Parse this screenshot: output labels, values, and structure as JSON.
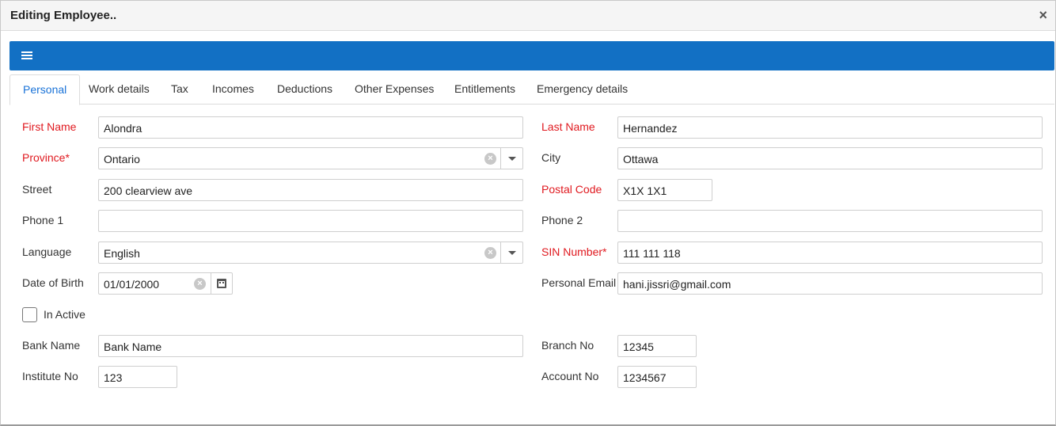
{
  "window": {
    "title": "Editing Employee..",
    "close_glyph": "×"
  },
  "toolbar": {
    "menu_icon": "hamburger-menu-icon",
    "color": "#1270c4"
  },
  "tabs": [
    {
      "label": "Personal",
      "active": true
    },
    {
      "label": "Work details"
    },
    {
      "label": "Tax"
    },
    {
      "label": "Incomes"
    },
    {
      "label": "Deductions"
    },
    {
      "label": "Other Expenses"
    },
    {
      "label": "Entitlements"
    },
    {
      "label": "Emergency details"
    }
  ],
  "colors": {
    "accent": "#1a73d8",
    "required_label": "#e0191f"
  },
  "form": {
    "first_name": {
      "label": "First Name",
      "value": "Alondra",
      "required": true
    },
    "last_name": {
      "label": "Last Name",
      "value": "Hernandez",
      "required": true
    },
    "province": {
      "label": "Province*",
      "value": "Ontario",
      "required": true
    },
    "city": {
      "label": "City",
      "value": "Ottawa"
    },
    "street": {
      "label": "Street",
      "value": "200 clearview ave"
    },
    "postal_code": {
      "label": "Postal Code",
      "value": "X1X 1X1",
      "required": true
    },
    "phone1": {
      "label": "Phone 1",
      "value": ""
    },
    "phone2": {
      "label": "Phone 2",
      "value": ""
    },
    "language": {
      "label": "Language",
      "value": "English"
    },
    "sin": {
      "label": "SIN Number*",
      "value": "111 111 118",
      "required": true
    },
    "dob": {
      "label": "Date of Birth",
      "value": "01/01/2000"
    },
    "email": {
      "label": "Personal Email",
      "value": "hani.jissri@gmail.com"
    },
    "inactive": {
      "label": "In Active",
      "checked": false
    },
    "bank_name": {
      "label": "Bank Name",
      "value": "Bank Name"
    },
    "branch_no": {
      "label": "Branch No",
      "value": "12345"
    },
    "institute_no": {
      "label": "Institute No",
      "value": "123"
    },
    "account_no": {
      "label": "Account No",
      "value": "1234567"
    }
  }
}
